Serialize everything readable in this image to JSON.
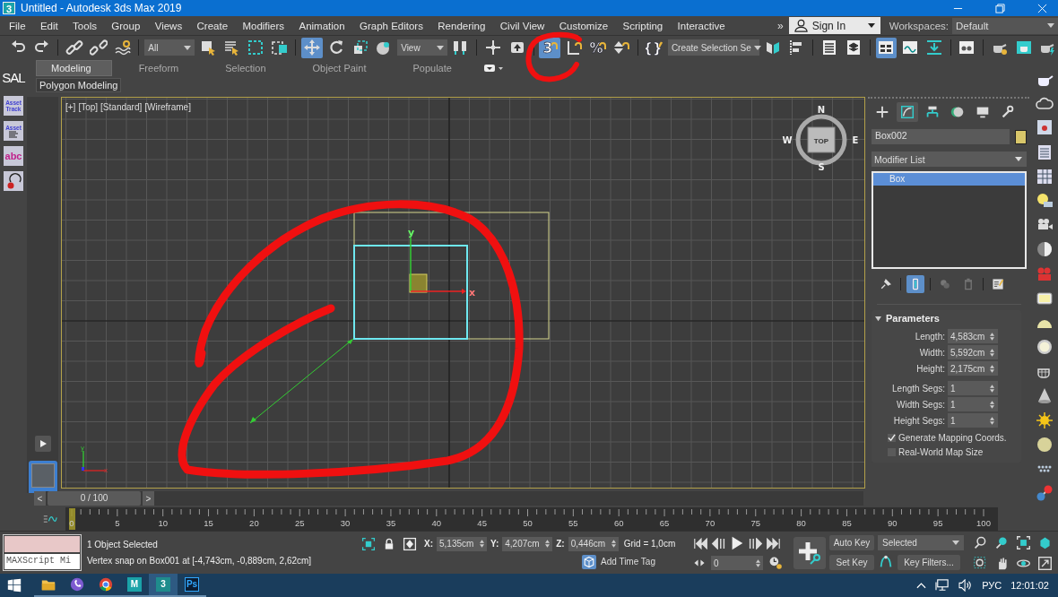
{
  "window": {
    "app_icon": "3",
    "title": "Untitled - Autodesk 3ds Max 2019"
  },
  "menu": [
    "File",
    "Edit",
    "Tools",
    "Group",
    "Views",
    "Create",
    "Modifiers",
    "Animation",
    "Graph Editors",
    "Rendering",
    "Civil View",
    "Customize",
    "Scripting",
    "Interactive"
  ],
  "account": {
    "overflow": "»",
    "sign_in": "Sign In",
    "workspaces_label": "Workspaces:",
    "workspace": "Default"
  },
  "toolbar": [
    {
      "items": [
        {
          "kind": "undo",
          "selected": false
        },
        {
          "kind": "redo",
          "selected": false
        }
      ]
    },
    {
      "items": [
        {
          "kind": "link",
          "selected": false
        },
        {
          "kind": "unlink",
          "selected": false
        },
        {
          "kind": "bind",
          "selected": false
        }
      ]
    },
    {
      "items": [
        {
          "kind": "dropdown",
          "value": "All"
        },
        {
          "kind": "select",
          "selected": false
        },
        {
          "kind": "select-name",
          "selected": false
        },
        {
          "kind": "region",
          "selected": false
        },
        {
          "kind": "crossing",
          "selected": false
        }
      ]
    },
    {
      "items": [
        {
          "kind": "move",
          "selected": true
        },
        {
          "kind": "rotate",
          "selected": false
        },
        {
          "kind": "scale",
          "selected": false
        },
        {
          "kind": "placement",
          "selected": false
        },
        {
          "kind": "dropdown",
          "value": "View"
        },
        {
          "kind": "pivot",
          "selected": false
        }
      ]
    },
    {
      "items": [
        {
          "kind": "manipulate",
          "selected": false
        },
        {
          "kind": "shortcut",
          "selected": false
        }
      ]
    },
    {
      "items": [
        {
          "kind": "snap",
          "label": "3",
          "selected": true
        },
        {
          "kind": "angle",
          "selected": false
        },
        {
          "kind": "percent",
          "label": "%",
          "selected": false
        },
        {
          "kind": "spinner",
          "selected": false
        }
      ]
    },
    {
      "items": [
        {
          "kind": "named-sets",
          "label": "{}",
          "selected": false
        },
        {
          "kind": "dropdown",
          "value": "Create Selection Se"
        },
        {
          "kind": "mirror",
          "selected": false
        },
        {
          "kind": "align",
          "selected": false
        }
      ]
    },
    {
      "items": [
        {
          "kind": "explorer",
          "selected": false
        },
        {
          "kind": "layers",
          "selected": false
        }
      ]
    },
    {
      "items": [
        {
          "kind": "ribbon",
          "selected": true
        },
        {
          "kind": "curve",
          "selected": false
        },
        {
          "kind": "schematic",
          "selected": false
        }
      ]
    },
    {
      "items": [
        {
          "kind": "material",
          "selected": false
        }
      ]
    },
    {
      "items": [
        {
          "kind": "render-setup",
          "selected": false
        },
        {
          "kind": "frame-window",
          "selected": false
        },
        {
          "kind": "render",
          "selected": false
        }
      ]
    }
  ],
  "ribbon": {
    "tabs": [
      {
        "label": "Modeling",
        "selected": true
      },
      {
        "label": "Freeform",
        "selected": false
      },
      {
        "label": "Selection",
        "selected": false
      },
      {
        "label": "Object Paint",
        "selected": false
      },
      {
        "label": "Populate",
        "selected": false
      }
    ],
    "panel": "Polygon Modeling"
  },
  "left_tools": [
    {
      "kind": "label",
      "label": "SAL"
    },
    {
      "kind": "tile",
      "label": "Asset Track"
    },
    {
      "kind": "tile-list",
      "label": "Asset"
    },
    {
      "kind": "tile-abc",
      "label": "abc"
    },
    {
      "kind": "tile-undo"
    }
  ],
  "viewport": {
    "active": true,
    "labels": [
      "[+]",
      "[Top]",
      "[Standard]",
      "[Wireframe]"
    ],
    "compass": {
      "north": "N",
      "west": "W",
      "east": "E",
      "south": "S",
      "cube": "TOP"
    },
    "gizmo": {
      "x": "x",
      "y": "y"
    },
    "tripod": {
      "x": "x",
      "y": "y"
    }
  },
  "command_panel": {
    "tabs": [
      {
        "kind": "create",
        "selected": false
      },
      {
        "kind": "modify",
        "selected": true
      },
      {
        "kind": "hierarchy",
        "selected": false
      },
      {
        "kind": "motion",
        "selected": false
      },
      {
        "kind": "display",
        "selected": false
      },
      {
        "kind": "utilities",
        "selected": false
      }
    ],
    "object": {
      "name": "Box002",
      "color": "#d8c66a"
    },
    "modifier_list": "Modifier List",
    "stack": [
      {
        "label": "Box",
        "selected": true
      }
    ],
    "stack_tools": [
      {
        "kind": "pin",
        "selected": false
      },
      {
        "kind": "end-result",
        "selected": true
      },
      {
        "kind": "unique",
        "selected": false
      },
      {
        "kind": "remove",
        "selected": false
      },
      {
        "kind": "configure",
        "selected": false
      }
    ],
    "rollout": {
      "title": "Parameters",
      "expanded": true,
      "fields": [
        {
          "label": "Length:",
          "value": "4,583cm"
        },
        {
          "label": "Width:",
          "value": "5,592cm"
        },
        {
          "label": "Height:",
          "value": "2,175cm"
        }
      ],
      "segments": [
        {
          "label": "Length Segs:",
          "value": "1"
        },
        {
          "label": "Width Segs:",
          "value": "1"
        },
        {
          "label": "Height Segs:",
          "value": "1"
        }
      ],
      "checkboxes": [
        {
          "label": "Generate Mapping Coords.",
          "checked": true
        },
        {
          "label": "Real-World Map Size",
          "checked": false
        }
      ]
    }
  },
  "timeline": {
    "prev": "<",
    "frame": "0 / 100",
    "next": ">",
    "level": 0,
    "ticks": [
      "0",
      "5",
      "10",
      "15",
      "20",
      "25",
      "30",
      "35",
      "40",
      "45",
      "50",
      "55",
      "60",
      "65",
      "70",
      "75",
      "80",
      "85",
      "90",
      "95",
      "100"
    ]
  },
  "status": {
    "listener": "MAXScript Mi",
    "selection": "1 Object Selected",
    "prompt": "Vertex snap on Box001 at [-4,743cm, -0,889cm, 2,62cm]",
    "coords": [
      {
        "axis": "X:",
        "value": "5,135cm"
      },
      {
        "axis": "Y:",
        "value": "4,207cm"
      },
      {
        "axis": "Z:",
        "value": "0,446cm"
      }
    ],
    "grid": "Grid = 1,0cm",
    "time_tag": "Add Time Tag",
    "frame": "0",
    "auto_key": "Auto Key",
    "key_mode": "Selected",
    "set_key": "Set Key",
    "key_filters": "Key Filters..."
  },
  "taskbar": {
    "apps": [
      {
        "kind": "folder",
        "selected": false
      },
      {
        "kind": "viber",
        "selected": false
      },
      {
        "kind": "chrome",
        "selected": false
      },
      {
        "kind": "letter",
        "label": "M",
        "selected": false
      },
      {
        "kind": "letter",
        "label": "3",
        "selected": true
      },
      {
        "kind": "letter",
        "label": "Ps",
        "selected": false
      }
    ],
    "language": "РУС",
    "clock": "12:01:02"
  }
}
